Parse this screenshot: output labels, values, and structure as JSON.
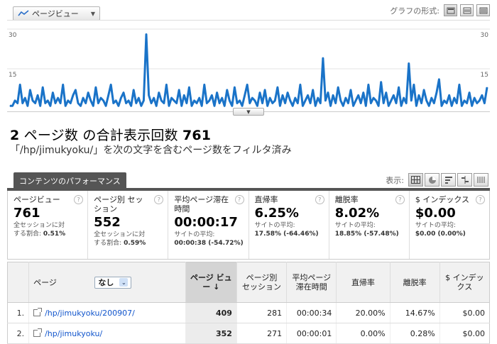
{
  "metric_select": {
    "label": "ページビュー"
  },
  "graph_type": {
    "label": "グラフの形式:"
  },
  "chart_data": {
    "type": "line",
    "ylim": [
      0,
      30
    ],
    "ticks": [
      "30",
      "15"
    ],
    "values": [
      1,
      1,
      3,
      2,
      9,
      2,
      4,
      1,
      7,
      3,
      2,
      5,
      1,
      8,
      2,
      3,
      1,
      6,
      2,
      4,
      2,
      9,
      1,
      3,
      2,
      5,
      7,
      2,
      1,
      4,
      2,
      6,
      3,
      1,
      8,
      2,
      4,
      3,
      1,
      5,
      9,
      2,
      3,
      1,
      4,
      6,
      2,
      3,
      1,
      7,
      2,
      4,
      1,
      3,
      28,
      5,
      2,
      4,
      1,
      6,
      3,
      2,
      9,
      1,
      4,
      3,
      2,
      7,
      1,
      5,
      2,
      8,
      1,
      3,
      2,
      4,
      1,
      9,
      2,
      3,
      5,
      1,
      6,
      2,
      4,
      1,
      7,
      3,
      1,
      8,
      2,
      3,
      1,
      5,
      9,
      2,
      4,
      3,
      1,
      6,
      2,
      7,
      1,
      4,
      2,
      3,
      8,
      1,
      5,
      2,
      6,
      3,
      1,
      4,
      2,
      9,
      1,
      3,
      5,
      2,
      7,
      1,
      4,
      2,
      19,
      3,
      6,
      1,
      5,
      2,
      8,
      3,
      1,
      4,
      2,
      7,
      1,
      3,
      5,
      2,
      6,
      1,
      9,
      2,
      4,
      3,
      1,
      10,
      2,
      6,
      1,
      3,
      5,
      2,
      8,
      1,
      4,
      2,
      17,
      3,
      9,
      1,
      5,
      2,
      7,
      3,
      1,
      4,
      2,
      6,
      11,
      1,
      3,
      2,
      5,
      1,
      4,
      2,
      9,
      1,
      3,
      2,
      6,
      1,
      4,
      2,
      3,
      5,
      2,
      8
    ]
  },
  "summary": {
    "count": "2",
    "prefix_text": " ページ数 の合計表示回数 ",
    "total": "761"
  },
  "filter_note": "「/hp/jimukyoku/」を次の文字を含むページ数をフィルタ済み",
  "section": {
    "tab": "コンテンツのパフォーマンス",
    "display_label": "表示:"
  },
  "kpis": [
    {
      "title": "ページビュー",
      "value": "761",
      "sub1": "全セッションに対",
      "sub2": "する割合: ",
      "sub2b": "0.51%"
    },
    {
      "title": "ページ別 セッション",
      "value": "552",
      "sub1": "全セッションに対",
      "sub2": "する割合: ",
      "sub2b": "0.59%"
    },
    {
      "title": "平均ページ滞在時間",
      "value": "00:00:17",
      "sub1": "サイトの平均:",
      "sub2": "00:00:38 ",
      "sub2b": "(-54.72%)",
      "tone": "neg"
    },
    {
      "title": "直帰率",
      "value": "6.25%",
      "sub1": "サイトの平均:",
      "sub2": "17.58% ",
      "sub2b": "(-64.46%)",
      "tone": "pos"
    },
    {
      "title": "離脱率",
      "value": "8.02%",
      "sub1": "サイトの平均:",
      "sub2": "18.85% ",
      "sub2b": "(-57.48%)",
      "tone": "pos"
    },
    {
      "title": "$ インデックス",
      "value": "$0.00",
      "sub1": "サイトの平均:",
      "sub2": "$0.00 ",
      "sub2b": "(0.00%)"
    }
  ],
  "table": {
    "page_header": "ページ",
    "secondary": "なし",
    "headers": [
      "ページ ビュー",
      "ページ別 セッション",
      "平均ページ 滞在時間",
      "直帰率",
      "離脱率",
      "$ インデッ クス"
    ],
    "rows": [
      {
        "idx": "1.",
        "page": "/hp/jimukyoku/200907/",
        "pv": "409",
        "sess": "281",
        "time": "00:00:34",
        "bounce": "20.00%",
        "exit": "14.67%",
        "index": "$0.00"
      },
      {
        "idx": "2.",
        "page": "/hp/jimukyoku/",
        "pv": "352",
        "sess": "271",
        "time": "00:00:01",
        "bounce": "0.00%",
        "exit": "0.28%",
        "index": "$0.00"
      }
    ]
  },
  "colors": {
    "line": "#1a73c8",
    "section": "#555555"
  }
}
